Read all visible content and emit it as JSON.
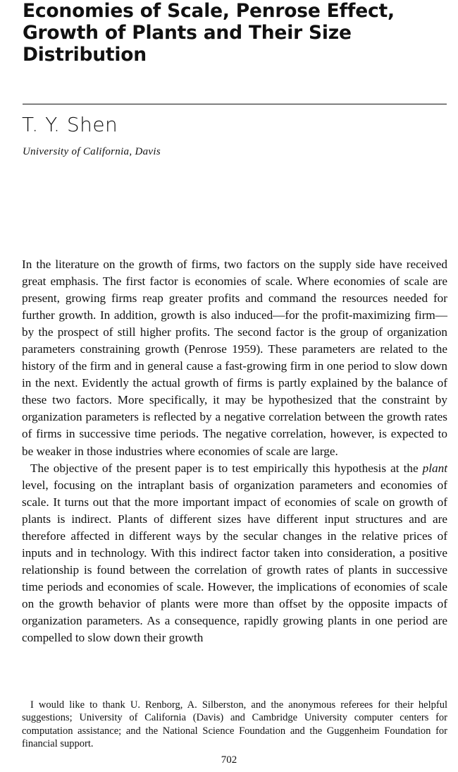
{
  "title": "Economies of Scale, Penrose Effect, Growth of Plants and Their Size Distribution",
  "author": "T. Y. Shen",
  "affiliation": "University of California, Davis",
  "paragraph1": "In the literature on the growth of firms, two factors on the supply side have received great emphasis. The first factor is economies of scale. Where economies of scale are present, growing firms reap greater profits and command the resources needed for further growth. In addition, growth is also induced—for the profit-maximizing firm—by the prospect of still higher profits. The second factor is the group of organization parameters constraining growth (Penrose 1959). These parameters are related to the history of the firm and in general cause a fast-growing firm in one period to slow down in the next. Evidently the actual growth of firms is partly explained by the balance of these two factors. More specifically, it may be hypothesized that the constraint by organization parameters is reflected by a negative correlation between the growth rates of firms in successive time periods. The negative correlation, however, is expected to be weaker in those industries where economies of scale are large.",
  "paragraph2": {
    "before_italic": "The objective of the present paper is to test empirically this hypothesis at the ",
    "italic": "plant",
    "after_italic": " level, focusing on the intraplant basis of organization parameters and economies of scale. It turns out that the more important impact of economies of scale on growth of plants is indirect. Plants of different sizes have different input structures and are therefore affected in different ways by the secular changes in the relative prices of inputs and in technology. With this indirect factor taken into consideration, a positive relationship is found between the correlation of growth rates of plants in successive time periods and economies of scale. However, the implications of economies of scale on the growth behavior of plants were more than offset by the opposite impacts of organization parameters. As a consequence, rapidly growing plants in one period are compelled to slow down their growth"
  },
  "footnote": "I would like to thank U. Renborg, A. Silberston, and the anonymous referees for their helpful suggestions; University of California (Davis) and Cambridge University computer centers for computation assistance; and the National Science Foundation and the Guggenheim Foundation for financial support.",
  "page_number": "702"
}
